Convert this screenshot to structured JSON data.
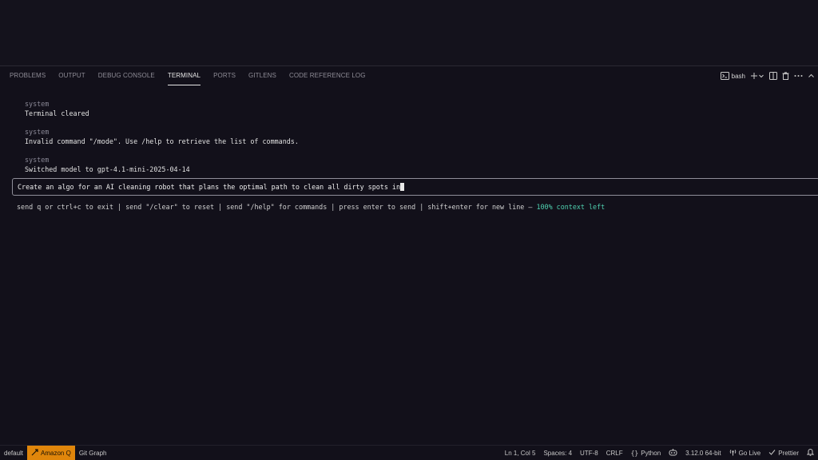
{
  "panel": {
    "tabs": [
      {
        "label": "PROBLEMS"
      },
      {
        "label": "OUTPUT"
      },
      {
        "label": "DEBUG CONSOLE"
      },
      {
        "label": "TERMINAL"
      },
      {
        "label": "PORTS"
      },
      {
        "label": "GITLENS"
      },
      {
        "label": "CODE REFERENCE LOG"
      }
    ],
    "active_tab": "TERMINAL",
    "shell_label": "bash",
    "icons": [
      "terminal-icon",
      "plus-icon",
      "chevron-down-icon",
      "split-icon",
      "trash-icon",
      "more-icon",
      "chevron-up-icon"
    ]
  },
  "terminal": {
    "messages": [
      {
        "role": "system",
        "text": "Terminal cleared"
      },
      {
        "role": "system",
        "text": "Invalid command \"/mode\". Use /help to retrieve the list of commands."
      },
      {
        "role": "system",
        "text": "Switched model to gpt-4.1-mini-2025-04-14"
      }
    ],
    "input_value": "Create an algo for an AI cleaning robot that plans the optimal path to clean all dirty spots in",
    "hint": "send q or ctrl+c to exit | send \"/clear\" to reset | send \"/help\" for commands | press enter to send | shift+enter for new line – ",
    "context_left": "100% context left"
  },
  "statusbar": {
    "profile": "default",
    "amazon_q": "Amazon Q",
    "git_graph": "Git Graph",
    "position": "Ln 1, Col 5",
    "spaces": "Spaces: 4",
    "encoding": "UTF-8",
    "eol": "CRLF",
    "language": "Python",
    "interpreter": "3.12.0 64-bit",
    "go_live": "Go Live",
    "prettier": "Prettier",
    "colors": {
      "amazon_bg": "#e0860b",
      "context": "#4fd1b0"
    }
  }
}
